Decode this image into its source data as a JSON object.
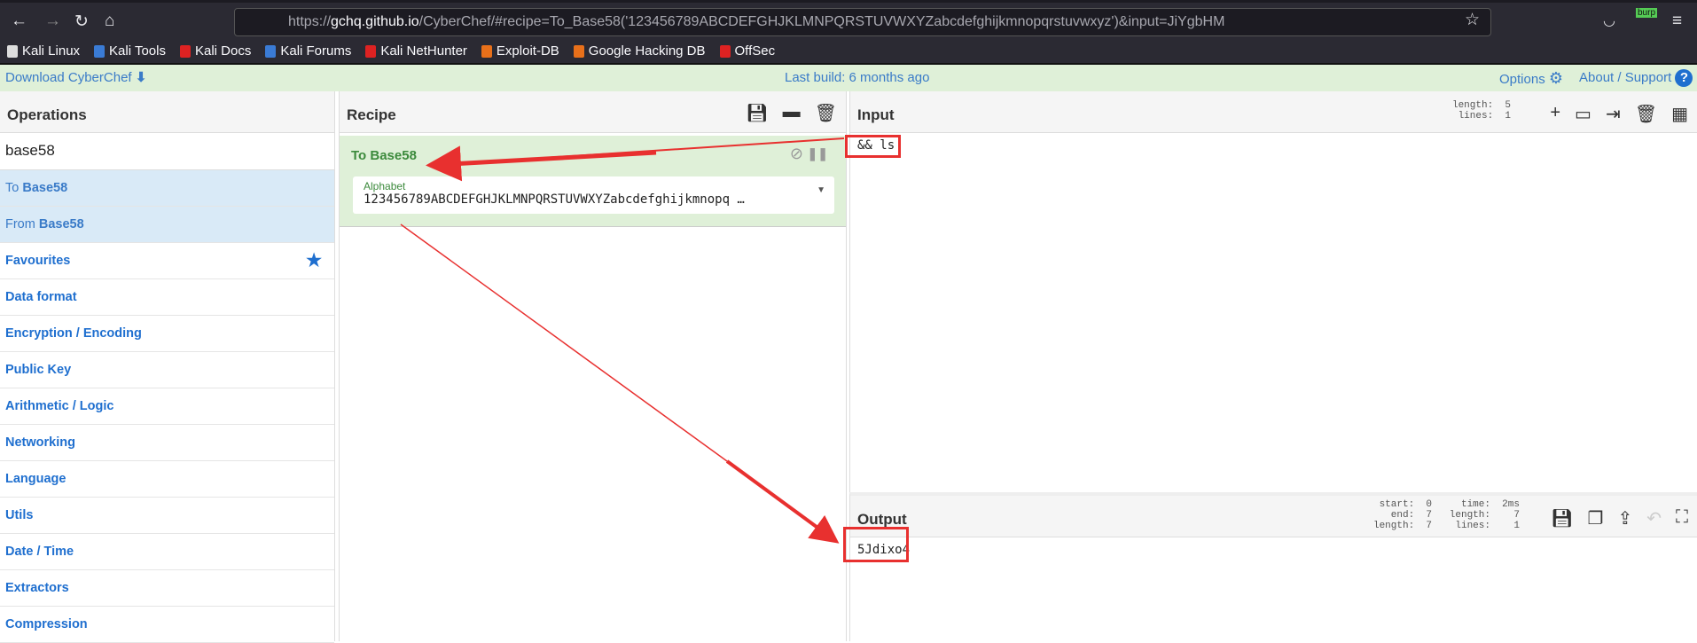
{
  "browser": {
    "url_prefix": "https://",
    "url_host": "gchq.github.io",
    "url_rest": "/CyberChef/#recipe=To_Base58('123456789ABCDEFGHJKLMNPQRSTUVWXYZabcdefghijkmnopqrstuvwxyz')&input=JiYgbHM",
    "burp_badge": "burp",
    "bookmarks": [
      {
        "label": "Kali Linux",
        "color": "#dddddd"
      },
      {
        "label": "Kali Tools",
        "color": "#3a7bd5"
      },
      {
        "label": "Kali Docs",
        "color": "#d22"
      },
      {
        "label": "Kali Forums",
        "color": "#3a7bd5"
      },
      {
        "label": "Kali NetHunter",
        "color": "#d22"
      },
      {
        "label": "Exploit-DB",
        "color": "#e8701a"
      },
      {
        "label": "Google Hacking DB",
        "color": "#e8701a"
      },
      {
        "label": "OffSec",
        "color": "#d22"
      }
    ]
  },
  "banner": {
    "download": "Download CyberChef",
    "build": "Last build: 6 months ago",
    "options": "Options",
    "about": "About / Support"
  },
  "operations": {
    "title": "Operations",
    "search": "base58",
    "results": [
      {
        "prefix": "To ",
        "bold": "Base58"
      },
      {
        "prefix": "From ",
        "bold": "Base58"
      }
    ],
    "categories": [
      "Favourites",
      "Data format",
      "Encryption / Encoding",
      "Public Key",
      "Arithmetic / Logic",
      "Networking",
      "Language",
      "Utils",
      "Date / Time",
      "Extractors",
      "Compression"
    ]
  },
  "recipe": {
    "title": "Recipe",
    "op": {
      "name": "To Base58",
      "arg_label": "Alphabet",
      "arg_value": "123456789ABCDEFGHJKLMNPQRSTUVWXYZabcdefghijkmnopq …"
    }
  },
  "input": {
    "title": "Input",
    "stats": "length:  5\n lines:  1",
    "value": "&& ls"
  },
  "output": {
    "title": "Output",
    "stats": "start:  0     time:  2ms\n  end:  7   length:    7\nlength:  7    lines:    1",
    "value": "5Jdixo4"
  },
  "colors": {
    "annotation": "#e8302f",
    "accent": "#1f6fcf",
    "recipe_bg": "#dff0d8"
  }
}
